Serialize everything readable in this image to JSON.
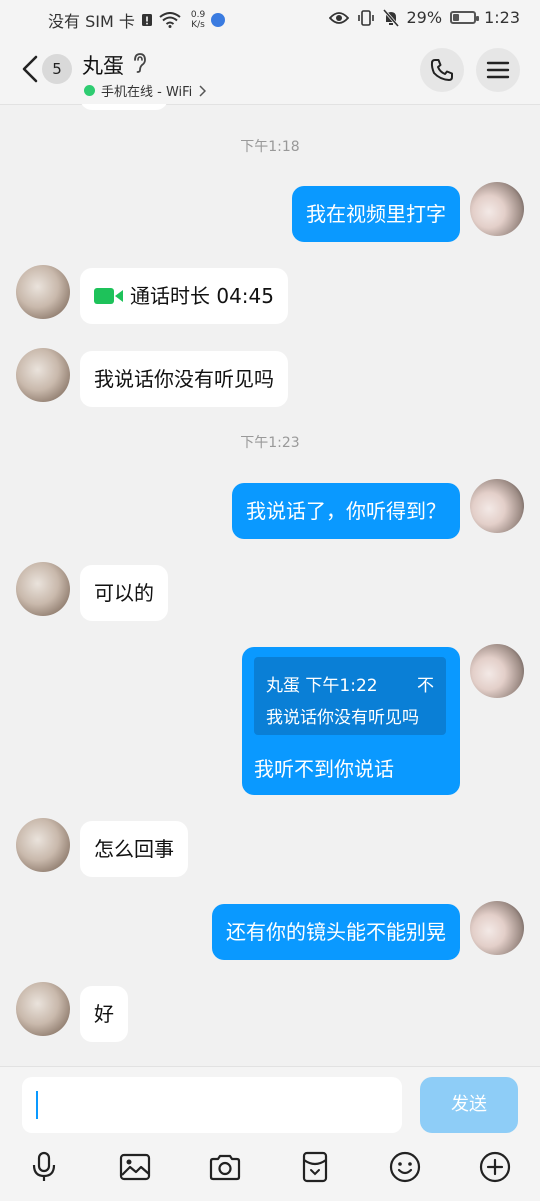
{
  "status_bar": {
    "sim": "没有 SIM 卡",
    "speed_value": "0.9",
    "speed_unit": "K/s",
    "battery": "29%",
    "battery_level": 0.29,
    "time": "1:23"
  },
  "header": {
    "unread_count": "5",
    "contact_name": "丸蛋",
    "online_status": "手机在线 - WiFi"
  },
  "messages": {
    "t1": "下午1:18",
    "m1": "我在视频里打字",
    "call": "通话时长 04:45",
    "m3": "我说话你没有听见吗",
    "t2": "下午1:23",
    "m4": "我说话了，你听得到？",
    "m5": "可以的",
    "quote_head": "丸蛋 下午1:22",
    "quote_close": "不",
    "quote_text": "我说话你没有听见吗",
    "quote_reply": "我听不到你说话",
    "m7": "怎么回事",
    "m8": "还有你的镜头能不能别晃",
    "m9": "好"
  },
  "input": {
    "value": "",
    "send_label": "发送"
  },
  "colors": {
    "bubble_out": "#0a99ff",
    "send_disabled": "#8ecdf7",
    "online": "#2ecc71",
    "video_icon": "#1ec25a"
  },
  "icons": [
    "wifi-icon",
    "eye-icon",
    "vibrate-icon",
    "mute-bell-icon",
    "back-arrow-icon",
    "ear-icon",
    "phone-icon",
    "menu-icon",
    "video-call-icon",
    "microphone-icon",
    "image-icon",
    "camera-icon",
    "red-packet-icon",
    "emoji-icon",
    "plus-icon"
  ]
}
